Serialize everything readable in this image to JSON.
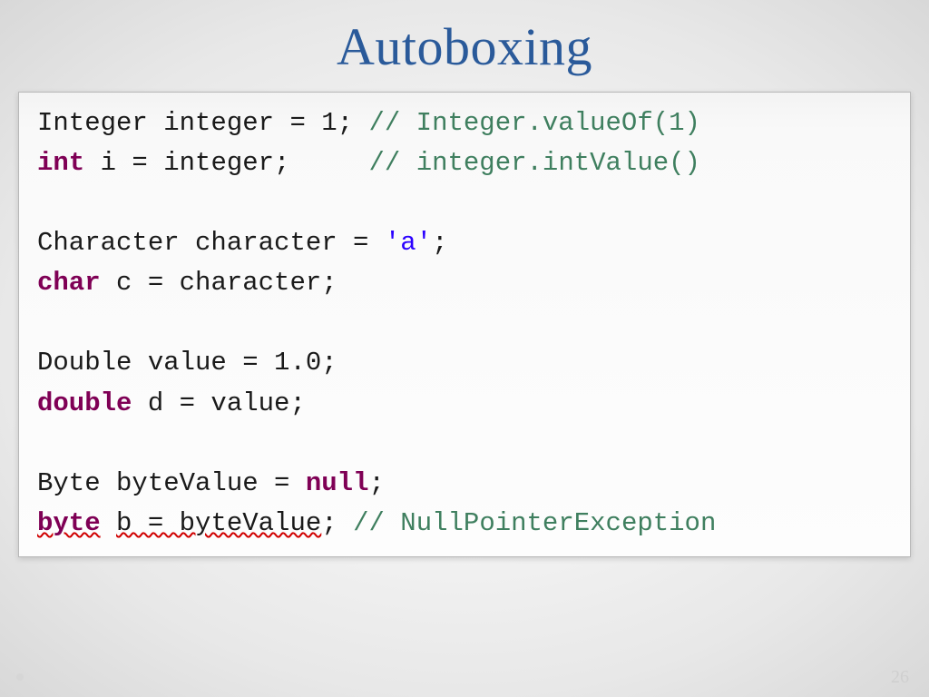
{
  "title": "Autoboxing",
  "page_number": "26",
  "code": {
    "l1_a": "Integer integer = 1; ",
    "l1_c": "// Integer.valueOf(1)",
    "l2_kw": "int",
    "l2_a": " i = integer;     ",
    "l2_c": "// integer.intValue()",
    "l3": "",
    "l4_a": "Character character = ",
    "l4_str": "'a'",
    "l4_b": ";",
    "l5_kw": "char",
    "l5_a": " c = character;",
    "l6": "",
    "l7_a": "Double value = 1.0;",
    "l8_kw": "double",
    "l8_a": " d = value;",
    "l9": "",
    "l10_a": "Byte byteValue = ",
    "l10_kw": "null",
    "l10_b": ";",
    "l11_kw": "byte",
    "l11_sp": " ",
    "l11_err": "b = byteValue",
    "l11_a": "; ",
    "l11_c": "// NullPointerException"
  }
}
